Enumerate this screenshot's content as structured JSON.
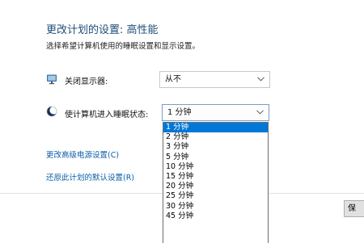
{
  "header": {
    "title": "更改计划的设置: 高性能",
    "subtitle": "选择希望计算机使用的睡眠设置和显示设置。"
  },
  "settings": {
    "display_off": {
      "icon": "monitor-icon",
      "label": "关闭显示器:",
      "value": "从不"
    },
    "sleep": {
      "icon": "moon-icon",
      "label": "使计算机进入睡眠状态:",
      "value": "1 分钟"
    }
  },
  "sleep_options": [
    "1 分钟",
    "2 分钟",
    "3 分钟",
    "5 分钟",
    "10 分钟",
    "15 分钟",
    "20 分钟",
    "25 分钟",
    "30 分钟",
    "45 分钟"
  ],
  "links": {
    "advanced": "更改高级电源设置(C)",
    "restore": "还原此计划的默认设置(R)"
  },
  "buttons": {
    "save_label": "保"
  },
  "colors": {
    "title": "#1f4e79",
    "link": "#0b5ea8",
    "selection": "#0078d7"
  }
}
